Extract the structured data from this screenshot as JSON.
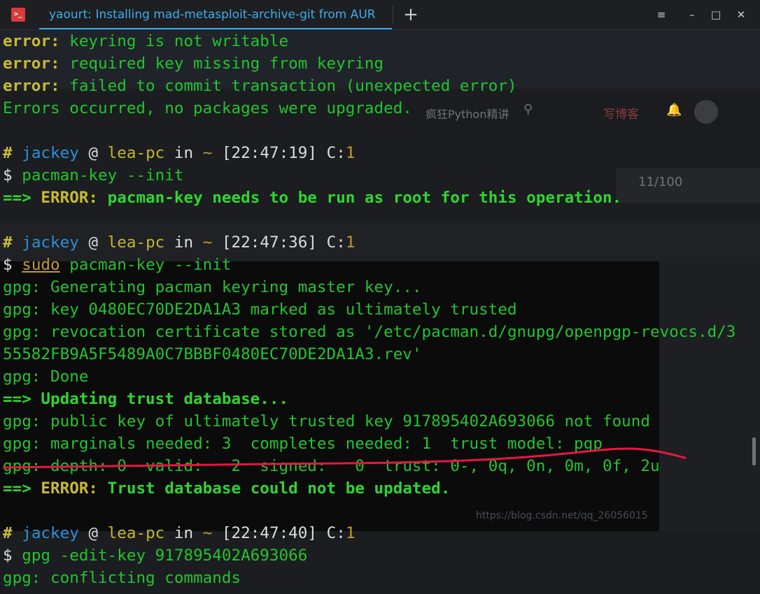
{
  "window": {
    "title": "yaourt: Installing mad-metasploit-archive-git from AUR",
    "app_icon_text": ">_",
    "new_tab_symbol": "+",
    "menu_symbol": "≡",
    "minimize_symbol": "–",
    "maximize_symbol": "□",
    "close_symbol": "✕"
  },
  "background_ghost": {
    "search_text": "疯狂Python精讲",
    "write_blog": "写博客",
    "counter": "11/100",
    "watermark": "https://blog.csdn.net/qq_26056015"
  },
  "terminal": {
    "error_word": "error:",
    "err1": " keyring is not writable",
    "err2": " required key missing from keyring",
    "err3": " failed to commit transaction (unexpected error)",
    "errors_occurred": "Errors occurred, no packages were upgraded.",
    "prompt_hash": "#",
    "user": "jackey",
    "at": "@",
    "host": "lea-pc",
    "in": "in",
    "tilde": "~",
    "exit_code_label": "C:",
    "exit_code_value": "1",
    "prompt_dollar": "$",
    "time1": "[22:47:19]",
    "cmd1": "pacman-key --init",
    "arrow": "==>",
    "error_label": "ERROR:",
    "msg_root": " pacman-key needs to be run as root for this operation.",
    "time2": "[22:47:36]",
    "sudo": "sudo",
    "cmd2_rest": " pacman-key --init",
    "gpg_prefix": "gpg:",
    "gpg1": " Generating pacman keyring master key...",
    "gpg2": " key 0480EC70DE2DA1A3 marked as ultimately trusted",
    "gpg3": " revocation certificate stored as '/etc/pacman.d/gnupg/openpgp-revocs.d/3",
    "gpg3b": "55582FB9A5F5489A0C7BBBF0480EC70DE2DA1A3.rev'",
    "gpg4": " Done",
    "updating": " Updating trust database...",
    "gpg5": " public key of ultimately trusted key 917895402A693066 not found",
    "gpg6": " marginals needed: 3  completes needed: 1  trust model: pgp",
    "gpg7": " depth: 0  valid:   2  signed:   0  trust: 0-, 0q, 0n, 0m, 0f, 2u",
    "trust_fail": " Trust database could not be updated.",
    "time3": "[22:47:40]",
    "cmd3": "gpg -edit-key 917895402A693066",
    "gpg8": " conflicting commands"
  },
  "colors": {
    "error": "#b6b32a",
    "green": "#23c42f",
    "accent": "#3daee9",
    "annotation": "#e8173f"
  }
}
